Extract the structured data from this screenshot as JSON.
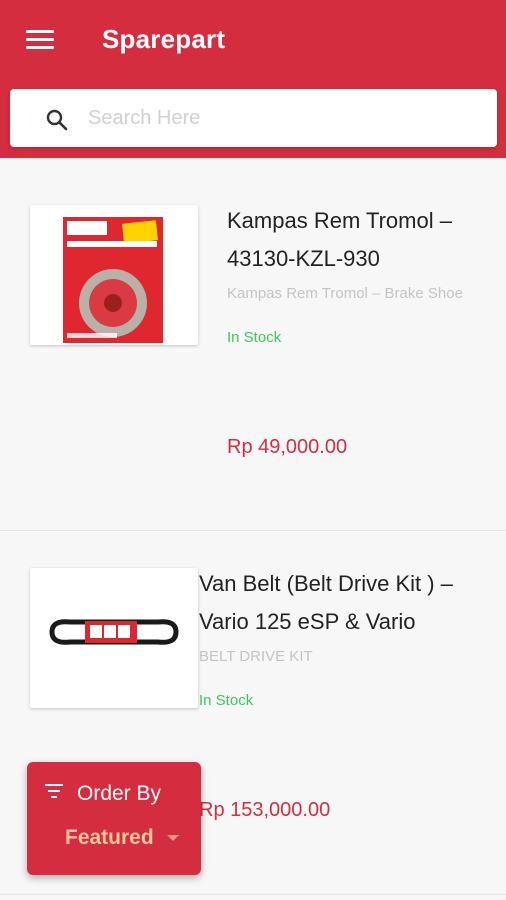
{
  "app": {
    "title": "Sparepart",
    "accent": "#d42d3f"
  },
  "search": {
    "placeholder": "Search Here",
    "value": ""
  },
  "products": [
    {
      "name": "Kampas Rem Tromol – 43130-KZL-930",
      "description": "Kampas Rem Tromol – Brake Shoe",
      "stock": "In Stock",
      "price": "Rp 49,000.00",
      "image": "brake-shoe-package"
    },
    {
      "name": "Van Belt (Belt Drive Kit ) – Vario 125 eSP & Vario",
      "description": "BELT DRIVE KIT",
      "stock": "In Stock",
      "price": "Rp 153,000.00",
      "image": "drive-belt"
    }
  ],
  "order": {
    "label": "Order By",
    "value": "Featured"
  }
}
